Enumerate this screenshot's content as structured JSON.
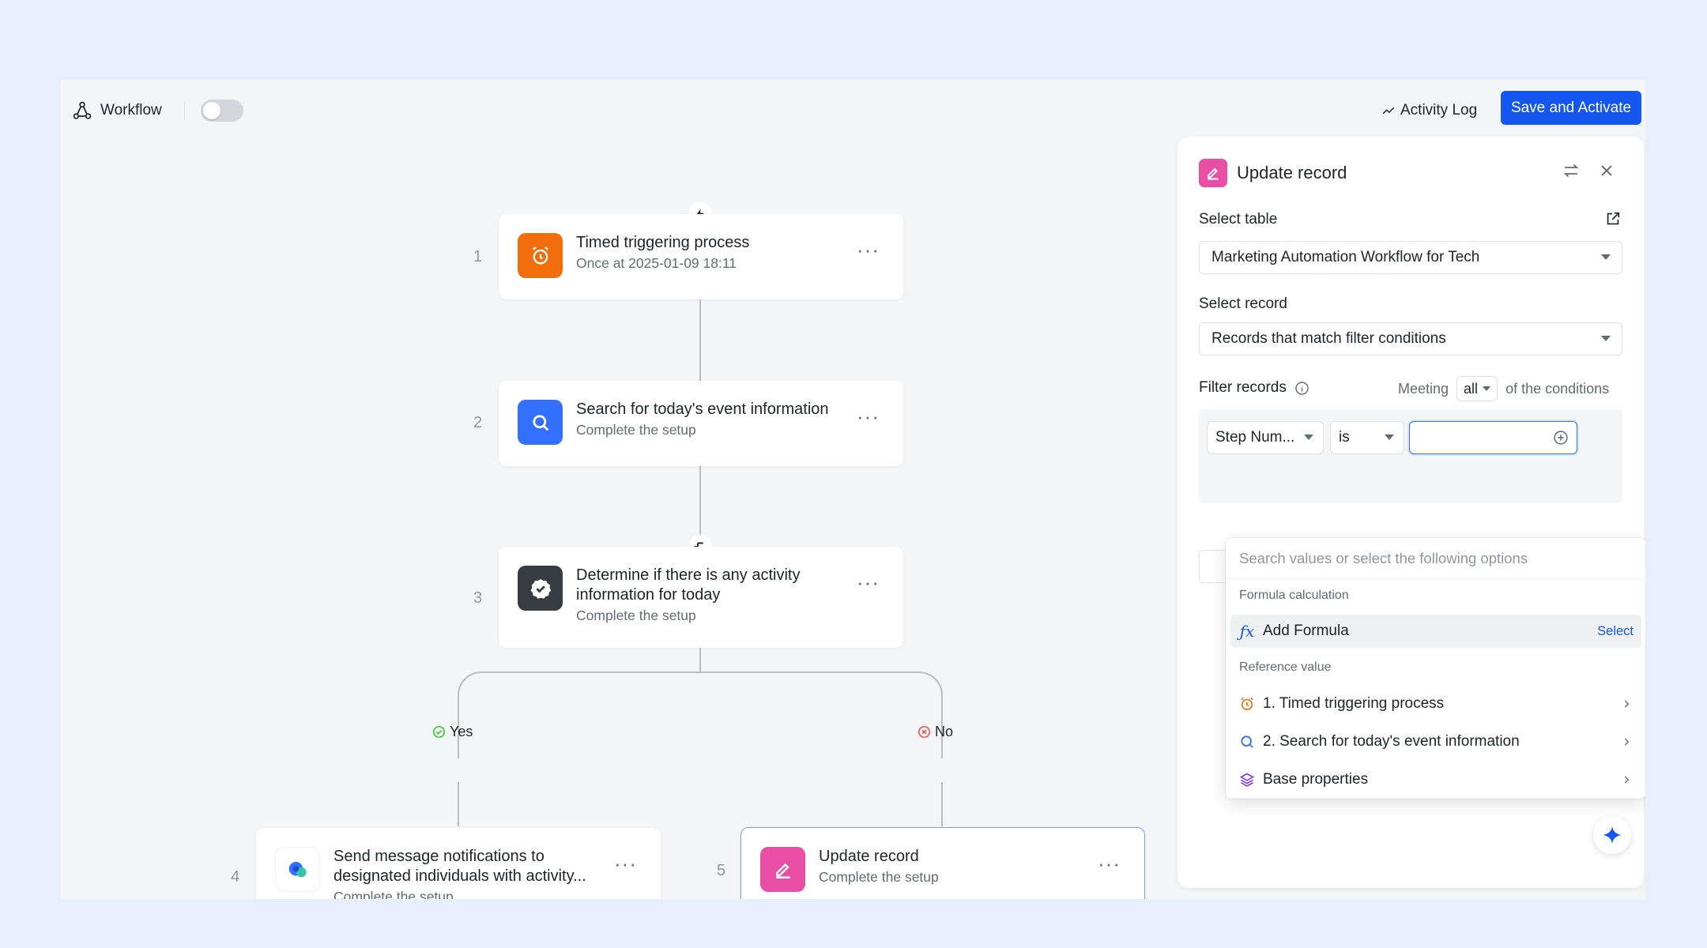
{
  "topbar": {
    "workflow_label": "Workflow",
    "activity_log": "Activity Log",
    "save_activate": "Save and Activate"
  },
  "nodes": [
    {
      "num": "1",
      "title": "Timed triggering process",
      "subtitle": "Once at 2025-01-09 18:11",
      "icon": "alarm-clock-icon",
      "color": "#f26e0d"
    },
    {
      "num": "2",
      "title": "Search for today's event information",
      "subtitle": "Complete the setup",
      "icon": "search-icon",
      "color": "#3370ff"
    },
    {
      "num": "3",
      "title_line1": "Determine if there is any activity",
      "title_line2": "information for today",
      "subtitle": "Complete the setup",
      "icon": "check-badge-icon",
      "color": "#373c43"
    },
    {
      "num": "4",
      "title_line1": "Send message notifications to",
      "title_line2": "designated individuals with activity...",
      "subtitle": "Complete the setup",
      "icon": "message-bubble-icon"
    },
    {
      "num": "5",
      "title": "Update record",
      "subtitle": "Complete the setup",
      "icon": "edit-icon",
      "color": "#e74ea4"
    }
  ],
  "branches": {
    "yes": "Yes",
    "no": "No"
  },
  "panel": {
    "title": "Update record",
    "select_table_label": "Select table",
    "select_table_value": "Marketing Automation Workflow for Tech",
    "select_record_label": "Select record",
    "select_record_value": "Records that match filter conditions",
    "filter_label": "Filter records",
    "meeting": "Meeting",
    "meeting_value": "all",
    "of_conditions": "of the conditions",
    "field_value": "Step Num...",
    "operator_value": "is"
  },
  "dropdown": {
    "search_placeholder": "Search values or select the following options",
    "group_formula": "Formula calculation",
    "add_formula": "Add Formula",
    "select": "Select",
    "group_reference": "Reference value",
    "ref1": "1. Timed triggering process",
    "ref2": "2. Search for today's event information",
    "ref3": "Base properties"
  },
  "colors": {
    "accent": "#1456f0",
    "yes": "#34c724",
    "no": "#f54a45"
  }
}
